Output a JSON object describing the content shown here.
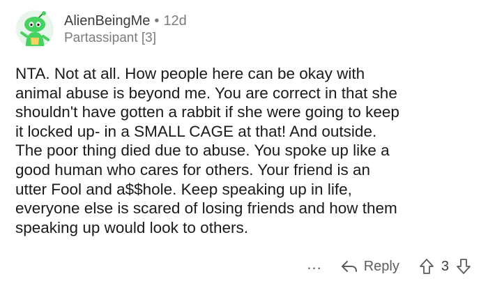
{
  "comment": {
    "author": "AlienBeingMe",
    "separator": "•",
    "age": "12d",
    "flair": "Partassipant [3]",
    "body_lines": [
      "NTA.  Not at all. How people here can be okay with",
      "animal abuse is beyond me. You are correct in that she",
      "shouldn't have gotten a rabbit if she were going to keep",
      "it locked up- in a SMALL CAGE at that! And outside.",
      "The poor thing died due to abuse. You spoke up like a",
      "good human who cares for others. Your friend is an",
      "utter Fool and a$$hole. Keep speaking up in life,",
      "everyone else is scared of losing friends and how them",
      "speaking up would look to others."
    ]
  },
  "actions": {
    "more_label": "...",
    "reply_label": "Reply",
    "vote_count": "3"
  },
  "icons": {
    "avatar": "snoo-avatar-icon",
    "reply": "reply-arrow-icon",
    "upvote": "upvote-arrow-icon",
    "downvote": "downvote-arrow-icon"
  },
  "colors": {
    "text": "#1a1a1b",
    "muted": "#7c7c7c",
    "avatar_green": "#46d160"
  }
}
